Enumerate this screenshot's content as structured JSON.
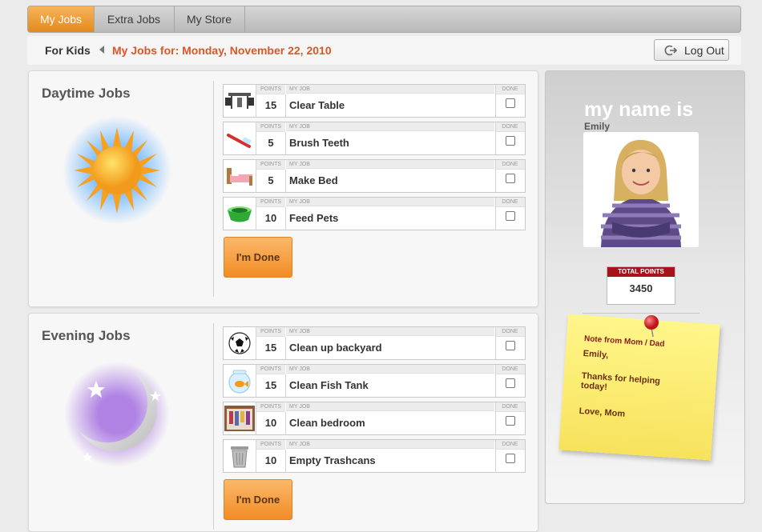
{
  "nav": {
    "tabs": [
      "My Jobs",
      "Extra Jobs",
      "My Store"
    ],
    "active": "My Jobs"
  },
  "subbar": {
    "section": "For Kids",
    "date_label": "My Jobs for: Monday, November 22, 2010",
    "logout": "Log Out"
  },
  "column_headers": {
    "points": "POINTS",
    "job": "MY JOB",
    "done": "DONE"
  },
  "daytime": {
    "title": "Daytime Jobs",
    "jobs": [
      {
        "icon": "table-chairs-icon",
        "points": "15",
        "job": "Clear Table"
      },
      {
        "icon": "toothbrush-icon",
        "points": "5",
        "job": "Brush Teeth"
      },
      {
        "icon": "bed-icon",
        "points": "5",
        "job": "Make Bed"
      },
      {
        "icon": "pet-bowl-icon",
        "points": "10",
        "job": "Feed Pets"
      }
    ],
    "done_button": "I'm Done"
  },
  "evening": {
    "title": "Evening Jobs",
    "jobs": [
      {
        "icon": "soccer-ball-icon",
        "points": "15",
        "job": "Clean up backyard"
      },
      {
        "icon": "fishbowl-icon",
        "points": "15",
        "job": "Clean Fish Tank"
      },
      {
        "icon": "closet-icon",
        "points": "10",
        "job": "Clean bedroom"
      },
      {
        "icon": "trash-can-icon",
        "points": "10",
        "job": "Empty Trashcans"
      }
    ],
    "done_button": "I'm Done"
  },
  "profile": {
    "heading": "my name is",
    "name": "Emily",
    "total_label": "TOTAL POINTS",
    "total_points": "3450"
  },
  "note": {
    "header": "Note from Mom / Dad",
    "greeting": "Emily,",
    "body": "Thanks for helping today!",
    "signoff": "Love, Mom"
  },
  "colors": {
    "accent_orange": "#f28c25",
    "date_red": "#d9572a",
    "note_header": "#8b1a1a"
  }
}
